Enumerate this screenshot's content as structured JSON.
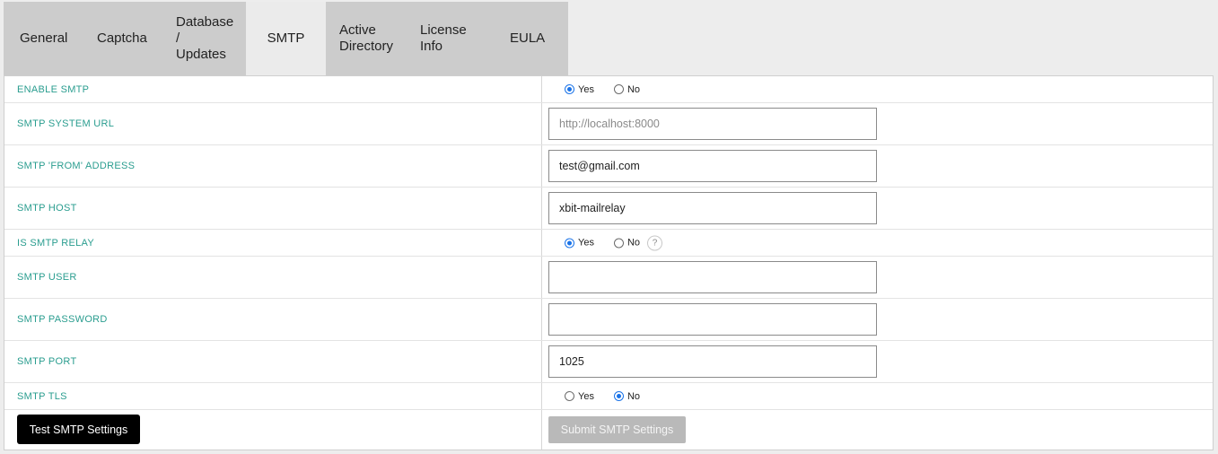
{
  "tabs": [
    {
      "label": "General"
    },
    {
      "label": "Captcha"
    },
    {
      "label": "Database\n/\nUpdates"
    },
    {
      "label": "SMTP",
      "active": true
    },
    {
      "label": "Active\nDirectory"
    },
    {
      "label": "License\nInfo"
    },
    {
      "label": "EULA"
    }
  ],
  "form": {
    "enable_smtp": {
      "label": "ENABLE SMTP",
      "yes": "Yes",
      "no": "No",
      "selected": "Yes"
    },
    "system_url": {
      "label": "SMTP SYSTEM URL",
      "placeholder": "http://localhost:8000",
      "value": ""
    },
    "from_address": {
      "label": "SMTP 'FROM' ADDRESS",
      "value": "test@gmail.com"
    },
    "host": {
      "label": "SMTP HOST",
      "value": "xbit-mailrelay"
    },
    "relay": {
      "label": "IS SMTP RELAY",
      "yes": "Yes",
      "no": "No",
      "selected": "Yes",
      "help": "?"
    },
    "user": {
      "label": "SMTP USER",
      "value": ""
    },
    "password": {
      "label": "SMTP PASSWORD",
      "value": ""
    },
    "port": {
      "label": "SMTP PORT",
      "value": "1025"
    },
    "tls": {
      "label": "SMTP TLS",
      "yes": "Yes",
      "no": "No",
      "selected": "No"
    }
  },
  "buttons": {
    "test": "Test SMTP Settings",
    "submit": "Submit SMTP Settings"
  },
  "colors": {
    "label": "#2a9d8f",
    "radio_checked": "#1a73e8",
    "tab_bar": "#cccccc",
    "submit_disabled": "#b9b9b9"
  }
}
